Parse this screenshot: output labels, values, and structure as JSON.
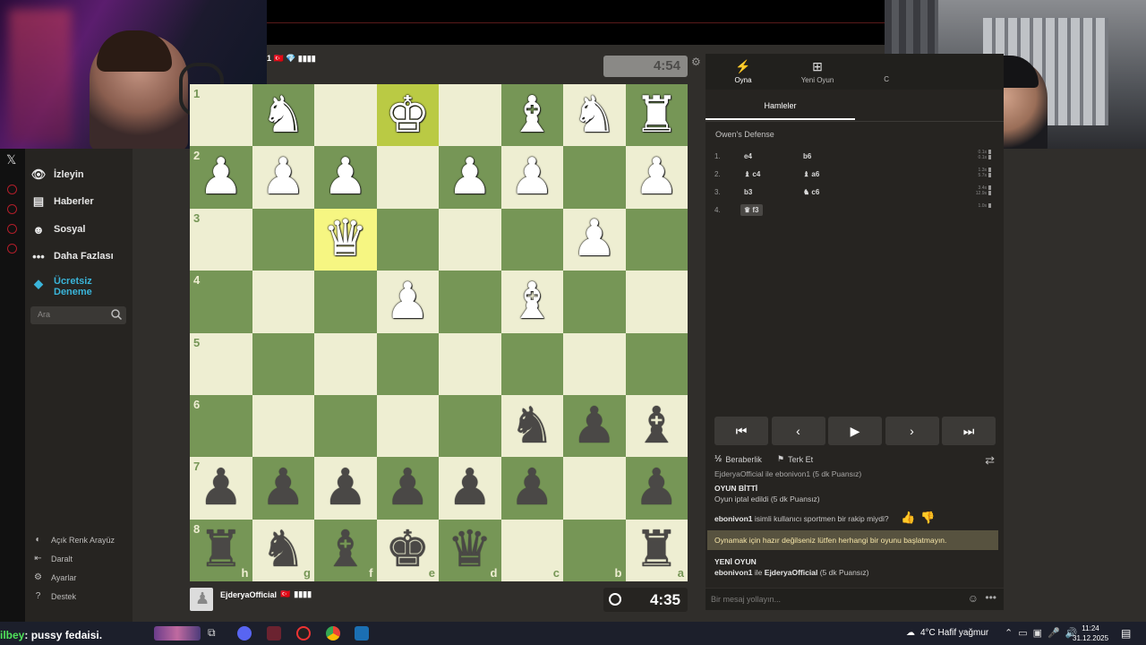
{
  "top_player": {
    "suffix": "1 🇹🇷 💎 ▮▮▮▮",
    "clock": "4:54"
  },
  "bottom_player": {
    "name": "EjderyaOfficial",
    "flag": "🇹🇷",
    "bars": "▮▮▮▮",
    "clock": "4:35"
  },
  "sidebar": {
    "items": [
      {
        "label": "İzleyin",
        "icon": "binoculars-icon"
      },
      {
        "label": "Haberler",
        "icon": "newspaper-icon"
      },
      {
        "label": "Sosyal",
        "icon": "people-icon"
      },
      {
        "label": "Daha Fazlası",
        "icon": "more-icon"
      }
    ],
    "trial": "Ücretsiz Deneme",
    "search_placeholder": "Ara",
    "bottom": [
      "Açık Renk Arayüz",
      "Daralt",
      "Ayarlar",
      "Destek"
    ]
  },
  "board": {
    "ranks": [
      "1",
      "2",
      "3",
      "4",
      "5",
      "6",
      "7",
      "8"
    ],
    "files": [
      "h",
      "g",
      "f",
      "e",
      "d",
      "c",
      "b",
      "a"
    ],
    "highlight": [
      "e1",
      "f3"
    ],
    "pieces": [
      {
        "sq": "g1",
        "p": "♞",
        "c": "w"
      },
      {
        "sq": "e1",
        "p": "♚",
        "c": "w"
      },
      {
        "sq": "c1",
        "p": "♝",
        "c": "w"
      },
      {
        "sq": "b1",
        "p": "♞",
        "c": "w"
      },
      {
        "sq": "a1",
        "p": "♜",
        "c": "w"
      },
      {
        "sq": "h2",
        "p": "♟",
        "c": "w"
      },
      {
        "sq": "g2",
        "p": "♟",
        "c": "w"
      },
      {
        "sq": "f2",
        "p": "♟",
        "c": "w"
      },
      {
        "sq": "d2",
        "p": "♟",
        "c": "w"
      },
      {
        "sq": "c2",
        "p": "♟",
        "c": "w"
      },
      {
        "sq": "a2",
        "p": "♟",
        "c": "w"
      },
      {
        "sq": "f3",
        "p": "♛",
        "c": "w"
      },
      {
        "sq": "b3",
        "p": "♟",
        "c": "w"
      },
      {
        "sq": "e4",
        "p": "♟",
        "c": "w"
      },
      {
        "sq": "c4",
        "p": "♝",
        "c": "w"
      },
      {
        "sq": "c6",
        "p": "♞",
        "c": "b"
      },
      {
        "sq": "b6",
        "p": "♟",
        "c": "b"
      },
      {
        "sq": "a6",
        "p": "♝",
        "c": "b"
      },
      {
        "sq": "h7",
        "p": "♟",
        "c": "b"
      },
      {
        "sq": "g7",
        "p": "♟",
        "c": "b"
      },
      {
        "sq": "f7",
        "p": "♟",
        "c": "b"
      },
      {
        "sq": "e7",
        "p": "♟",
        "c": "b"
      },
      {
        "sq": "d7",
        "p": "♟",
        "c": "b"
      },
      {
        "sq": "c7",
        "p": "♟",
        "c": "b"
      },
      {
        "sq": "a7",
        "p": "♟",
        "c": "b"
      },
      {
        "sq": "h8",
        "p": "♜",
        "c": "b"
      },
      {
        "sq": "g8",
        "p": "♞",
        "c": "b"
      },
      {
        "sq": "f8",
        "p": "♝",
        "c": "b"
      },
      {
        "sq": "e8",
        "p": "♚",
        "c": "b"
      },
      {
        "sq": "d8",
        "p": "♛",
        "c": "b"
      },
      {
        "sq": "a8",
        "p": "♜",
        "c": "b"
      }
    ]
  },
  "panel": {
    "tabs": [
      {
        "label": "Oyna",
        "icon": "bolt-icon"
      },
      {
        "label": "Yeni Oyun",
        "icon": "plus-icon"
      },
      {
        "label": "C",
        "icon": ""
      }
    ],
    "subtab": "Hamleler",
    "opening": "Owen's Defense",
    "moves": [
      {
        "n": "1.",
        "w": "e4",
        "b": "b6",
        "t": [
          "0.1s",
          "0.1s"
        ]
      },
      {
        "n": "2.",
        "w": "♝ c4",
        "b": "♝ a6",
        "t": [
          "1.3s",
          "5.7s"
        ]
      },
      {
        "n": "3.",
        "w": "b3",
        "b": "♞ c6",
        "t": [
          "3.4s",
          "12.9s"
        ]
      },
      {
        "n": "4.",
        "w": "♛ f3",
        "b": "",
        "t": [
          "1.0s"
        ]
      }
    ],
    "nav": [
      "⏮",
      "‹",
      "▶",
      "›",
      "⏭"
    ],
    "actions": {
      "draw": "Beraberlik",
      "draw_icon": "½",
      "resign": "Terk Et"
    },
    "chat": {
      "cut_line": "EjderyaOfficial ile ebonivon1 (5 dk Puansız)",
      "game_over": "OYUN BİTTİ",
      "cancelled": "Oyun iptal edildi (5 dk Puansız)",
      "question_user": "ebonivon1",
      "question": "isimli kullanıcı sportmen bir rakip miydi?",
      "warning": "Oynamak için hazır değilseniz lütfen herhangi bir oyunu başlatmayın.",
      "new_game": "YENİ OYUN",
      "new_game_line_user1": "ebonivon1",
      "new_game_line_mid": "ile",
      "new_game_line_user2": "EjderyaOfficial",
      "new_game_line_tail": "(5 dk Puansız)",
      "input_placeholder": "Bir mesaj yollayın..."
    }
  },
  "taskbar": {
    "ticker_user": "ilbey",
    "ticker_text": ": pussy fedaisi.",
    "weather": "4°C  Hafif yağmur",
    "time": "11:24",
    "date": "31.12.2025"
  }
}
